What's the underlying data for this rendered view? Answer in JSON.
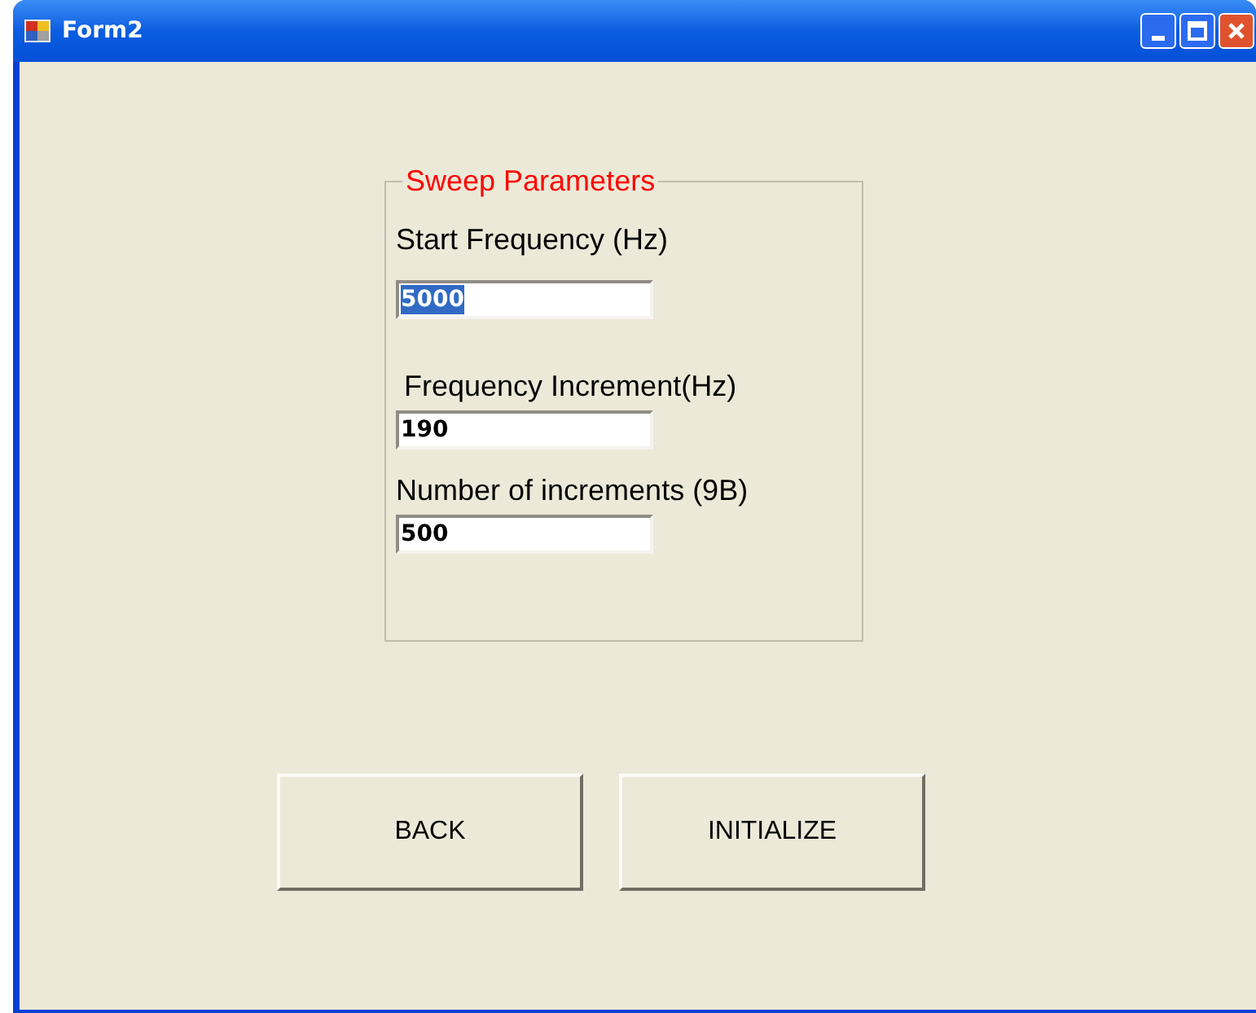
{
  "window": {
    "title": "Form2"
  },
  "group": {
    "title": "Sweep Parameters",
    "fields": [
      {
        "label": "Start Frequency (Hz)",
        "value": "5000",
        "selected": true
      },
      {
        "label": " Frequency Increment(Hz)",
        "value": "190",
        "selected": false
      },
      {
        "label": "Number of increments (9B)",
        "value": "500",
        "selected": false
      }
    ]
  },
  "buttons": [
    "BACK",
    "INITIALIZE"
  ]
}
